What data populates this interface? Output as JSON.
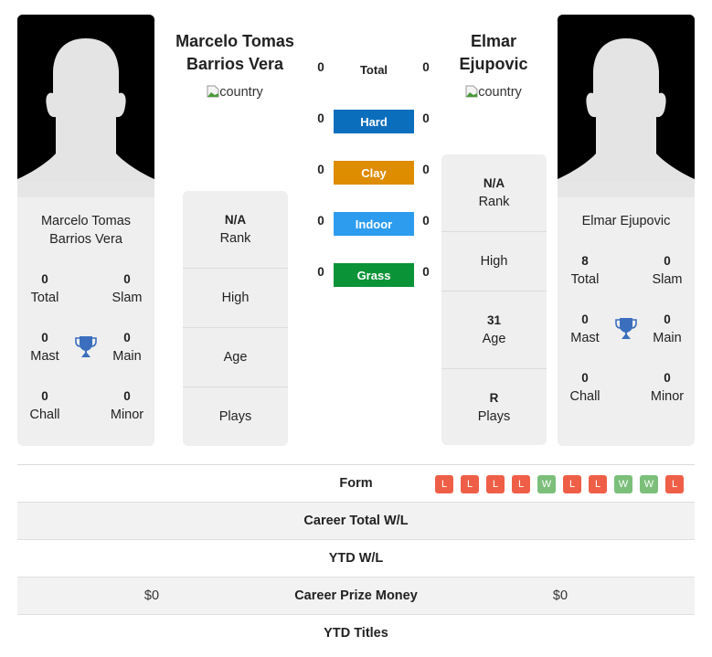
{
  "colors": {
    "hard": "#0a6ebd",
    "clay": "#de8c00",
    "indoor": "#2d9cef",
    "grass": "#0b9337",
    "win": "#7bbf7a",
    "loss": "#ef5f47",
    "trophy": "#3b6fbe"
  },
  "player1": {
    "name": "Marcelo Tomas Barrios Vera",
    "name_line1": "Marcelo Tomas",
    "name_line2": "Barrios Vera",
    "country_alt": "country",
    "card_name_line1": "Marcelo Tomas",
    "card_name_line2": "Barrios Vera",
    "titles": {
      "total": {
        "value": "0",
        "label": "Total"
      },
      "slam": {
        "value": "0",
        "label": "Slam"
      },
      "mast": {
        "value": "0",
        "label": "Mast"
      },
      "main": {
        "value": "0",
        "label": "Main"
      },
      "chall": {
        "value": "0",
        "label": "Chall"
      },
      "minor": {
        "value": "0",
        "label": "Minor"
      }
    },
    "info": {
      "rank": {
        "value": "N/A",
        "label": "Rank"
      },
      "high": {
        "value": "",
        "label": "High"
      },
      "age": {
        "value": "",
        "label": "Age"
      },
      "plays": {
        "value": "",
        "label": "Plays"
      }
    }
  },
  "player2": {
    "name": "Elmar Ejupovic",
    "name_line1": "Elmar",
    "name_line2": "Ejupovic",
    "country_alt": "country",
    "card_name": "Elmar Ejupovic",
    "titles": {
      "total": {
        "value": "8",
        "label": "Total"
      },
      "slam": {
        "value": "0",
        "label": "Slam"
      },
      "mast": {
        "value": "0",
        "label": "Mast"
      },
      "main": {
        "value": "0",
        "label": "Main"
      },
      "chall": {
        "value": "0",
        "label": "Chall"
      },
      "minor": {
        "value": "0",
        "label": "Minor"
      }
    },
    "info": {
      "rank": {
        "value": "N/A",
        "label": "Rank"
      },
      "high": {
        "value": "",
        "label": "High"
      },
      "age": {
        "value": "31",
        "label": "Age"
      },
      "plays": {
        "value": "R",
        "label": "Plays"
      }
    }
  },
  "h2h": [
    {
      "label": "Total",
      "p1": "0",
      "p2": "0"
    },
    {
      "label": "Hard",
      "p1": "0",
      "p2": "0"
    },
    {
      "label": "Clay",
      "p1": "0",
      "p2": "0"
    },
    {
      "label": "Indoor",
      "p1": "0",
      "p2": "0"
    },
    {
      "label": "Grass",
      "p1": "0",
      "p2": "0"
    }
  ],
  "table": {
    "form_label": "Form",
    "form": [
      "L",
      "L",
      "L",
      "L",
      "W",
      "L",
      "L",
      "W",
      "W",
      "L"
    ],
    "rows": [
      {
        "label": "Career Total W/L",
        "p1": "",
        "p2": ""
      },
      {
        "label": "YTD W/L",
        "p1": "",
        "p2": ""
      },
      {
        "label": "Career Prize Money",
        "p1": "$0",
        "p2": "$0"
      },
      {
        "label": "YTD Titles",
        "p1": "",
        "p2": ""
      }
    ]
  }
}
